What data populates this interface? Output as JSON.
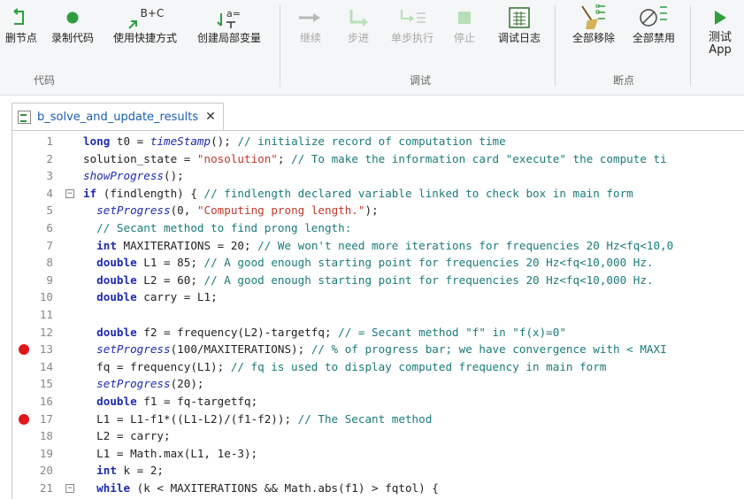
{
  "ribbon": {
    "buttons": [
      {
        "label": "删节点",
        "icon": "delete-node-icon",
        "disabled": false
      },
      {
        "label": "录制代码",
        "icon": "record-icon",
        "disabled": false
      },
      {
        "label": "使用快捷方式",
        "icon": "shortcut-icon",
        "disabled": false
      },
      {
        "label": "创建局部变量",
        "icon": "local-variable-icon",
        "disabled": false
      },
      {
        "label": "继续",
        "icon": "continue-icon",
        "disabled": true
      },
      {
        "label": "步进",
        "icon": "step-into-icon",
        "disabled": true
      },
      {
        "label": "单步执行",
        "icon": "step-over-icon",
        "disabled": true
      },
      {
        "label": "停止",
        "icon": "stop-icon",
        "disabled": true
      },
      {
        "label": "调试日志",
        "icon": "debug-log-icon",
        "disabled": false
      },
      {
        "label": "全部移除",
        "icon": "remove-all-icon",
        "disabled": false
      },
      {
        "label": "全部禁用",
        "icon": "disable-all-icon",
        "disabled": false
      },
      {
        "label": "测试 App",
        "icon": "run-app-icon",
        "disabled": false
      }
    ],
    "groups": [
      "代码",
      "调试",
      "断点"
    ],
    "icon_text": {
      "shortcut": "B+C",
      "local_var": "a="
    }
  },
  "tab": {
    "title": "b_solve_and_update_results",
    "close": "✕"
  },
  "editor": {
    "lines": [
      {
        "n": "1",
        "bp": false,
        "fold": false,
        "tokens": [
          [
            "kw",
            "long"
          ],
          [
            "",
            " t0 = "
          ],
          [
            "fn",
            "timeStamp"
          ],
          [
            "",
            "(); "
          ],
          [
            "cm",
            "// initialize record of computation time"
          ]
        ]
      },
      {
        "n": "2",
        "bp": false,
        "fold": false,
        "tokens": [
          [
            "",
            "solution_state = "
          ],
          [
            "st",
            "\"nosolution\""
          ],
          [
            "",
            "; "
          ],
          [
            "cm",
            "// To make the information card \"execute\" the compute ti"
          ]
        ]
      },
      {
        "n": "3",
        "bp": false,
        "fold": false,
        "tokens": [
          [
            "fn",
            "showProgress"
          ],
          [
            "",
            "();"
          ]
        ]
      },
      {
        "n": "4",
        "bp": false,
        "fold": true,
        "tokens": [
          [
            "kw",
            "if"
          ],
          [
            "",
            " (findlength) { "
          ],
          [
            "cm",
            "// findlength declared variable linked to check box in main form"
          ]
        ]
      },
      {
        "n": "5",
        "bp": false,
        "fold": false,
        "tokens": [
          [
            "",
            "  "
          ],
          [
            "fn",
            "setProgress"
          ],
          [
            "",
            "(0, "
          ],
          [
            "st",
            "\"Computing prong length.\""
          ],
          [
            "",
            ");"
          ]
        ]
      },
      {
        "n": "6",
        "bp": false,
        "fold": false,
        "tokens": [
          [
            "",
            "  "
          ],
          [
            "cm",
            "// Secant method to find prong length:"
          ]
        ]
      },
      {
        "n": "7",
        "bp": false,
        "fold": false,
        "tokens": [
          [
            "",
            "  "
          ],
          [
            "kw",
            "int"
          ],
          [
            "",
            " MAXITERATIONS = 20; "
          ],
          [
            "cm",
            "// We won't need more iterations for frequencies 20 Hz<fq<10,0"
          ]
        ]
      },
      {
        "n": "8",
        "bp": false,
        "fold": false,
        "tokens": [
          [
            "",
            "  "
          ],
          [
            "kw",
            "double"
          ],
          [
            "",
            " L1 = 85; "
          ],
          [
            "cm",
            "// A good enough starting point for frequencies 20 Hz<fq<10,000 Hz."
          ]
        ]
      },
      {
        "n": "9",
        "bp": false,
        "fold": false,
        "tokens": [
          [
            "",
            "  "
          ],
          [
            "kw",
            "double"
          ],
          [
            "",
            " L2 = 60; "
          ],
          [
            "cm",
            "// A good enough starting point for frequencies 20 Hz<fq<10,000 Hz."
          ]
        ]
      },
      {
        "n": "10",
        "bp": false,
        "fold": false,
        "tokens": [
          [
            "",
            "  "
          ],
          [
            "kw",
            "double"
          ],
          [
            "",
            " carry = L1;"
          ]
        ]
      },
      {
        "n": "11",
        "bp": false,
        "fold": false,
        "tokens": [
          [
            "",
            ""
          ]
        ]
      },
      {
        "n": "12",
        "bp": false,
        "fold": false,
        "tokens": [
          [
            "",
            "  "
          ],
          [
            "kw",
            "double"
          ],
          [
            "",
            " f2 = frequency(L2)-targetfq; "
          ],
          [
            "cm",
            "// = Secant method \"f\" in \"f(x)=0\""
          ]
        ]
      },
      {
        "n": "13",
        "bp": true,
        "fold": false,
        "tokens": [
          [
            "",
            "  "
          ],
          [
            "fn",
            "setProgress"
          ],
          [
            "",
            "(100/MAXITERATIONS); "
          ],
          [
            "cm",
            "// % of progress bar; we have convergence with < MAXI"
          ]
        ]
      },
      {
        "n": "14",
        "bp": false,
        "fold": false,
        "tokens": [
          [
            "",
            "  fq = frequency(L1); "
          ],
          [
            "cm",
            "// fq is used to display computed frequency in main form"
          ]
        ]
      },
      {
        "n": "15",
        "bp": false,
        "fold": false,
        "tokens": [
          [
            "",
            "  "
          ],
          [
            "fn",
            "setProgress"
          ],
          [
            "",
            "(20);"
          ]
        ]
      },
      {
        "n": "16",
        "bp": false,
        "fold": false,
        "tokens": [
          [
            "",
            "  "
          ],
          [
            "kw",
            "double"
          ],
          [
            "",
            " f1 = fq-targetfq;"
          ]
        ]
      },
      {
        "n": "17",
        "bp": true,
        "fold": false,
        "tokens": [
          [
            "",
            "  L1 = L1-f1*((L1-L2)/(f1-f2)); "
          ],
          [
            "cm",
            "// The Secant method"
          ]
        ]
      },
      {
        "n": "18",
        "bp": false,
        "fold": false,
        "tokens": [
          [
            "",
            "  L2 = carry;"
          ]
        ]
      },
      {
        "n": "19",
        "bp": false,
        "fold": false,
        "tokens": [
          [
            "",
            "  L1 = Math.max(L1, 1e-3);"
          ]
        ]
      },
      {
        "n": "20",
        "bp": false,
        "fold": false,
        "tokens": [
          [
            "",
            "  "
          ],
          [
            "kw",
            "int"
          ],
          [
            "",
            " k = 2;"
          ]
        ]
      },
      {
        "n": "21",
        "bp": false,
        "fold": true,
        "tokens": [
          [
            "",
            "  "
          ],
          [
            "kw",
            "while"
          ],
          [
            "",
            " (k < MAXITERATIONS && Math.abs(f1) > fqtol) {"
          ]
        ]
      }
    ]
  },
  "colors": {
    "keyword": "#1d2bb0",
    "comment": "#1a7a7a",
    "string": "#c0392b",
    "breakpoint": "#e0161a",
    "accent_green": "#2e9e3e"
  }
}
